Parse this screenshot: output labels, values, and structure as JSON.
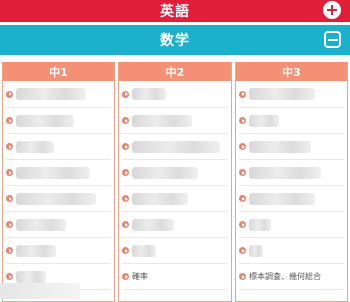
{
  "sections": {
    "english": {
      "title": "英語",
      "toggle": "expand"
    },
    "math": {
      "title": "数学",
      "toggle": "collapse"
    }
  },
  "colors": {
    "english_bar": "#e01e3a",
    "math_bar": "#1bb1cc",
    "grade_header": "#f39075"
  },
  "grades": [
    {
      "label": "中1",
      "visible_items": []
    },
    {
      "label": "中2",
      "visible_items": [
        "確率"
      ]
    },
    {
      "label": "中3",
      "visible_items": [
        "標本調査、幾何総合"
      ]
    }
  ]
}
